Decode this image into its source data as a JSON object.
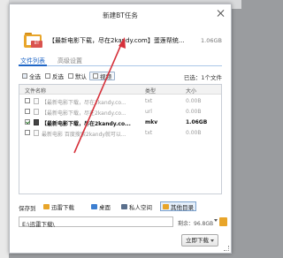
{
  "window": {
    "title": "新建BT任务"
  },
  "torrent": {
    "badge": "BT",
    "name": "【最新电影下载，尽在2kandy.com】蛋莲帮统...",
    "size": "1.06GB"
  },
  "tabs": [
    {
      "label": "文件列表"
    },
    {
      "label": "高级设置"
    }
  ],
  "toolbar": {
    "select_all": "全选",
    "invert": "反选",
    "default": "默认",
    "video": "视频",
    "selected_count": "已选：1个文件"
  },
  "file_list": {
    "headers": {
      "name": "文件名称",
      "type": "类型",
      "size": "大小"
    },
    "rows": [
      {
        "name": "【最新电影下载，尽在2kandy.co...",
        "type": "txt",
        "size": "0.00B",
        "checked": false
      },
      {
        "name": "【最新电影下载，尽在2kandy.co...",
        "type": "url",
        "size": "0.00B",
        "checked": false
      },
      {
        "name": "【最新电影下载，尽在2kandy.co...",
        "type": "mkv",
        "size": "1.06GB",
        "checked": true
      },
      {
        "name": "最新电影 百度搜索2kandy就可以...",
        "type": "txt",
        "size": "0.00B",
        "checked": false
      }
    ]
  },
  "save_to": {
    "label": "保存到",
    "options": [
      "迅雷下载",
      "桌面",
      "私人空间",
      "其他目录"
    ]
  },
  "path": {
    "value": "E:\\迅雷下载\\",
    "remaining": "剩余：96.8GB"
  },
  "actions": {
    "download_now": "立即下载"
  }
}
